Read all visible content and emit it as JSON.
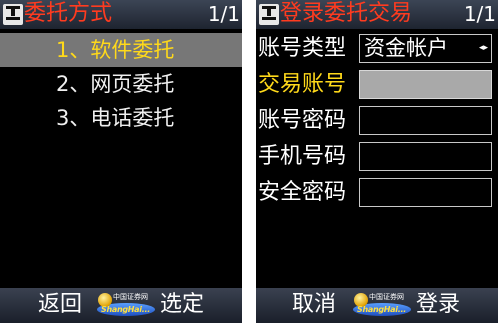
{
  "left": {
    "title": "委托方式",
    "page": "1/1",
    "items": [
      {
        "label": "1、软件委托"
      },
      {
        "label": "2、网页委托"
      },
      {
        "label": "3、电话委托"
      }
    ],
    "softkeys": {
      "left": "返回",
      "right": "选定"
    },
    "logo": {
      "top": "中国证券网",
      "text": "ShangHai..."
    }
  },
  "right": {
    "title": "登录委托交易",
    "page": "1/1",
    "fields": [
      {
        "label": "账号类型",
        "value": "资金帐户"
      },
      {
        "label": "交易账号",
        "value": ""
      },
      {
        "label": "账号密码",
        "value": ""
      },
      {
        "label": "手机号码",
        "value": ""
      },
      {
        "label": "安全密码",
        "value": ""
      }
    ],
    "softkeys": {
      "left": "取消",
      "right": "登录"
    },
    "logo": {
      "top": "中国证券网",
      "text": "ShangHai..."
    }
  },
  "colors": {
    "title": "#ff3b1f",
    "selected_text": "#ffd91a",
    "selected_bg": "#777777",
    "bar": "#2a303d"
  }
}
